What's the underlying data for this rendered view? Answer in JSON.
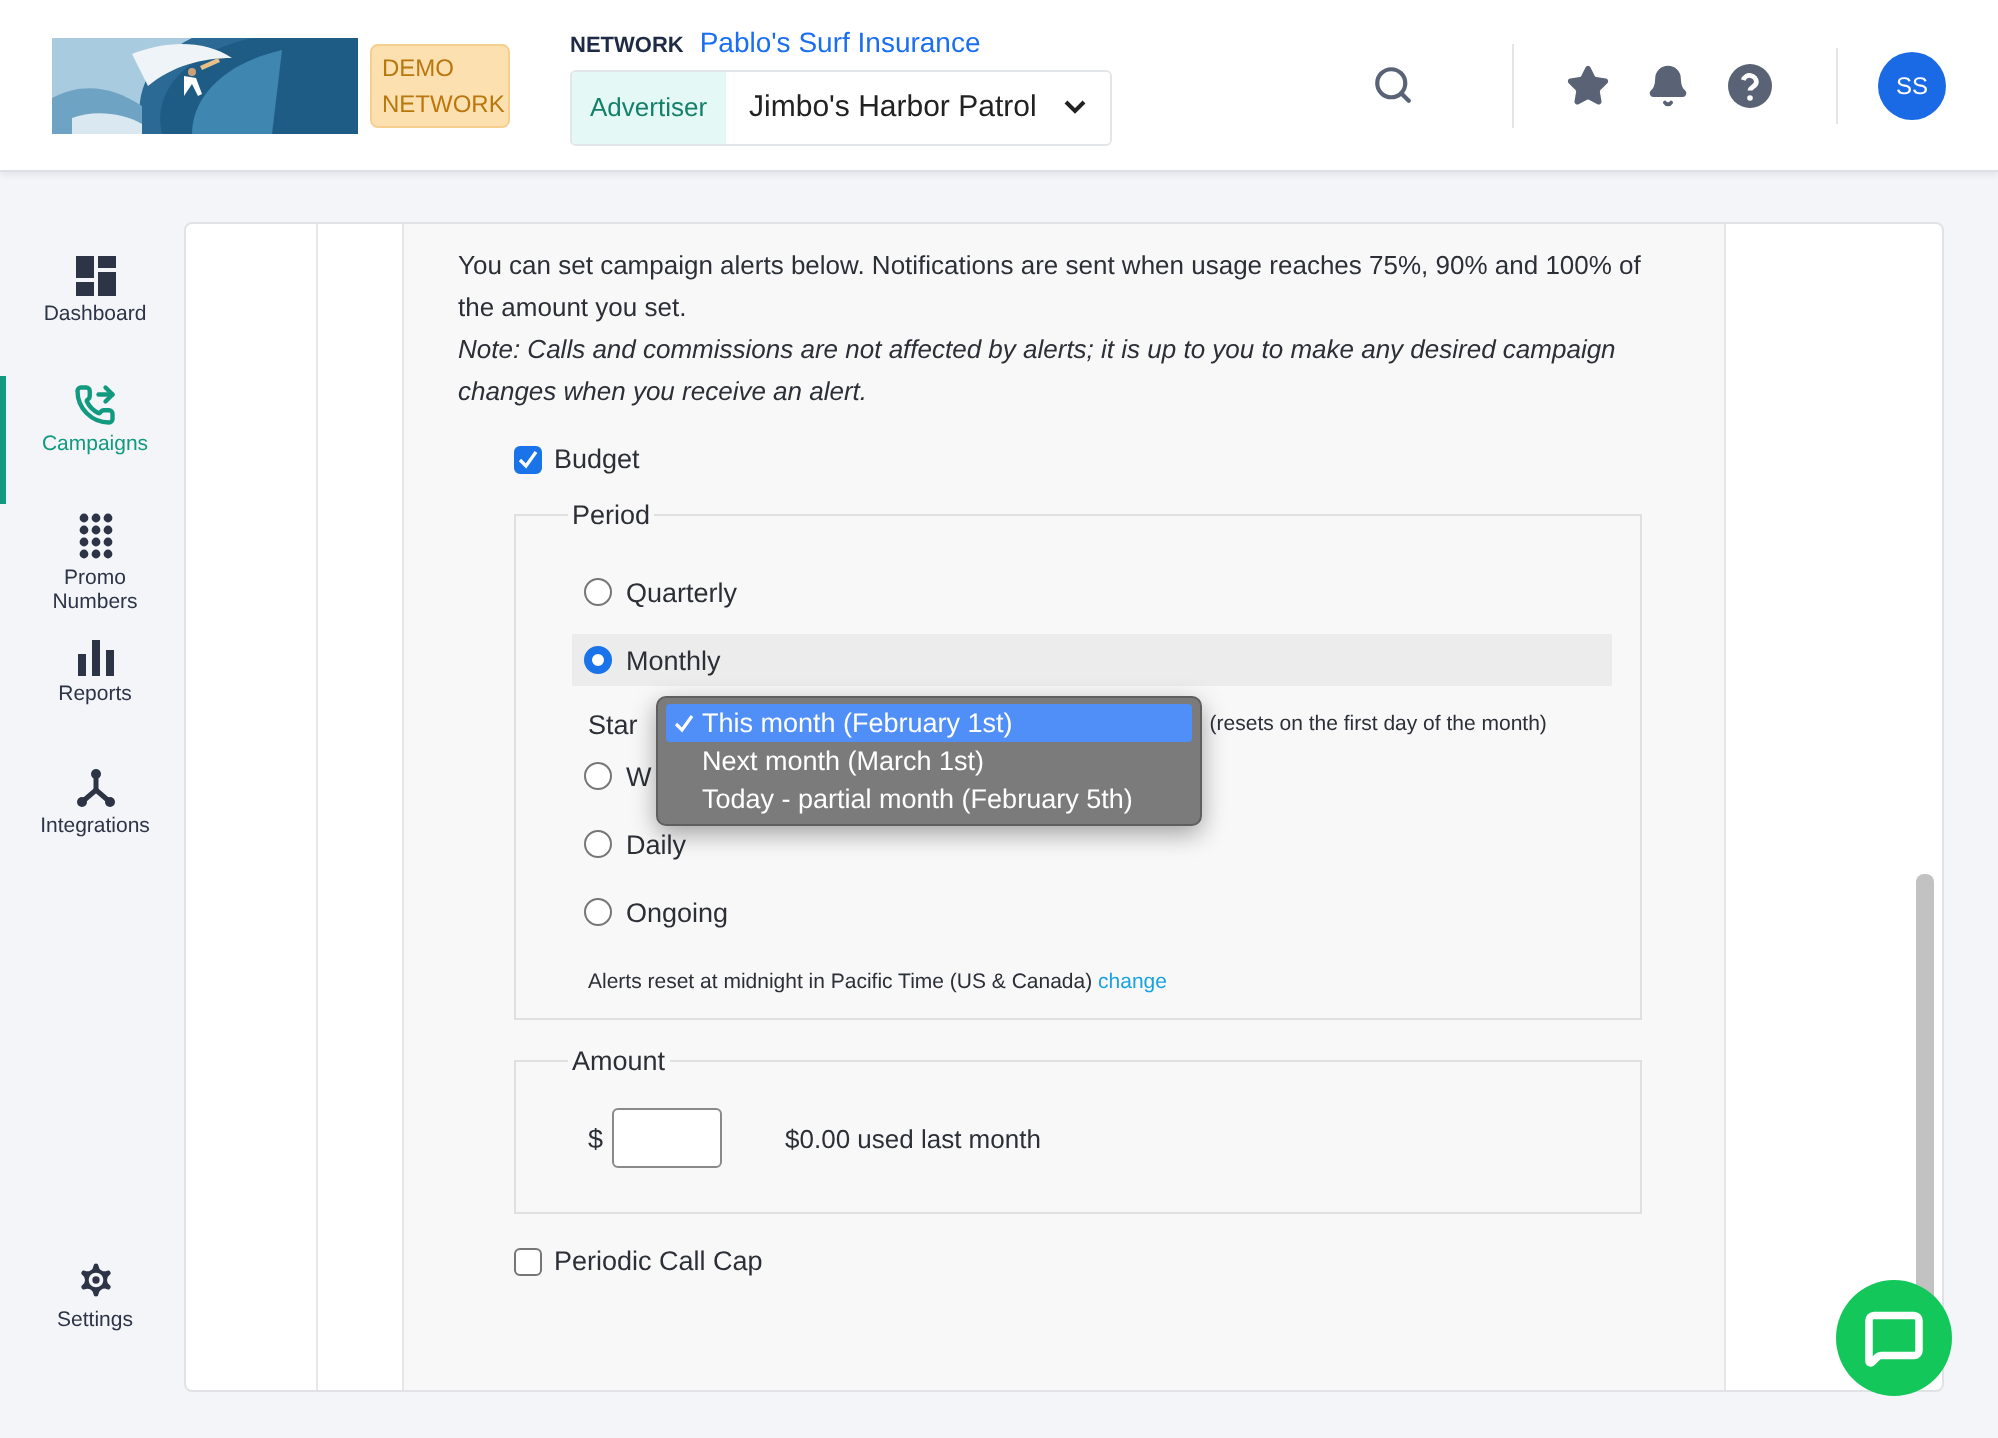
{
  "header": {
    "demo_badge": "DEMO NETWORK",
    "network_label": "NETWORK",
    "network_name": "Pablo's Surf Insurance",
    "advertiser_label": "Advertiser",
    "advertiser_value": "Jimbo's Harbor Patrol",
    "avatar": "SS"
  },
  "sidebar": {
    "items": [
      {
        "label": "Dashboard",
        "selected": false
      },
      {
        "label": "Campaigns",
        "selected": true
      },
      {
        "label": "Promo Numbers",
        "selected": false
      },
      {
        "label": "Reports",
        "selected": false
      },
      {
        "label": "Integrations",
        "selected": false
      }
    ],
    "settings": "Settings"
  },
  "intro": "You can set campaign alerts below. Notifications are sent when usage reaches 75%, 90% and 100% of the amount you set.",
  "note": "Note: Calls and commissions are not affected by alerts; it is up to you to make any desired campaign changes when you receive an alert.",
  "budget": {
    "label": "Budget",
    "checked": true
  },
  "period": {
    "legend": "Period",
    "options": [
      {
        "label": "Quarterly",
        "selected": false
      },
      {
        "label": "Monthly",
        "selected": true
      },
      {
        "label": "W",
        "selected": false
      },
      {
        "label": "Daily",
        "selected": false
      },
      {
        "label": "Ongoing",
        "selected": false
      }
    ],
    "start_label": "Star",
    "start_hint": "(resets on the first day of the month)",
    "dropdown": [
      {
        "label": "This month (February 1st)",
        "selected": true
      },
      {
        "label": "Next month (March 1st)",
        "selected": false
      },
      {
        "label": "Today - partial month (February 5th)",
        "selected": false
      }
    ],
    "reset_note": "Alerts reset at midnight in Pacific Time (US & Canada)",
    "reset_link": "change"
  },
  "amount": {
    "legend": "Amount",
    "currency": "$",
    "used": "$0.00 used last month"
  },
  "call_cap": {
    "label": "Periodic Call Cap",
    "checked": false
  }
}
